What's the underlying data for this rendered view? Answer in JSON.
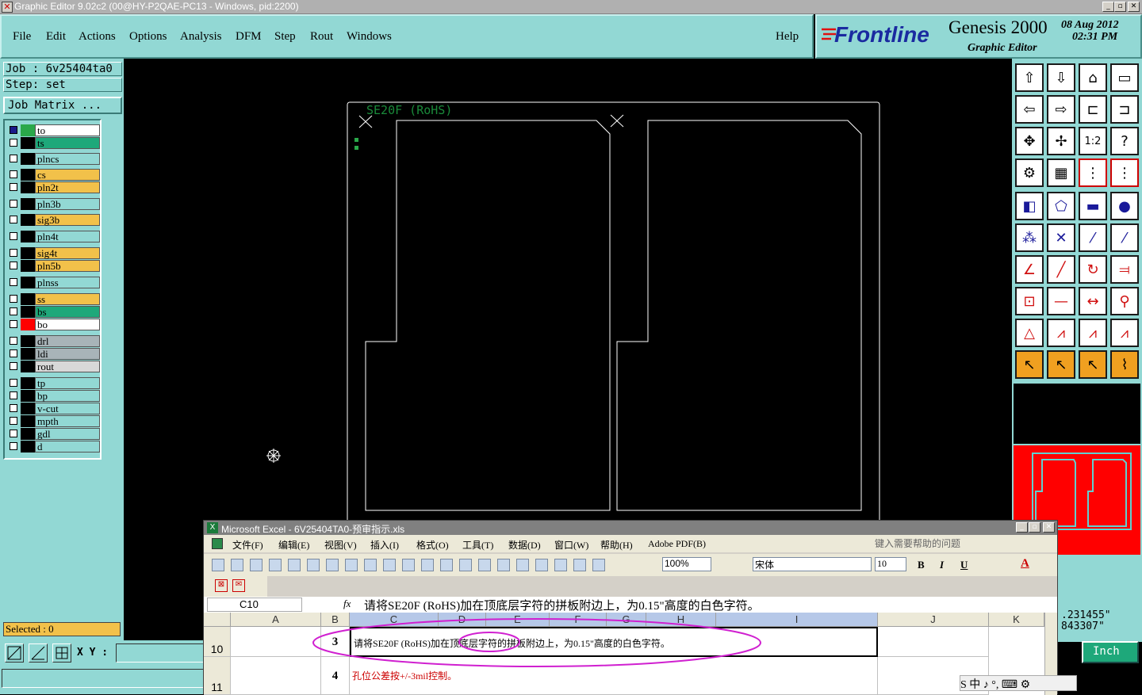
{
  "window": {
    "title": "Graphic Editor 9.02c2 (00@HY-P2QAE-PC13 - Windows, pid:2200)",
    "btn_min": "_",
    "btn_max": "▫",
    "btn_close": "✕"
  },
  "menu": {
    "items": [
      "File",
      "Edit",
      "Actions",
      "Options",
      "Analysis",
      "DFM",
      "Step",
      "Rout",
      "Windows"
    ],
    "help": "Help"
  },
  "brand": {
    "logo": "Frontline",
    "product": "Genesis 2000",
    "subtitle": "Graphic Editor",
    "date": "08 Aug 2012",
    "time": "02:31 PM"
  },
  "job": {
    "job": "Job : 6v25404ta0",
    "step": "Step: set",
    "matrix_button": "Job Matrix ..."
  },
  "layers": [
    {
      "name": "to",
      "color": "#ffffff",
      "accent": "#2aa84a"
    },
    {
      "name": "ts",
      "color": "#1ea87a",
      "accent": "#000000"
    },
    {
      "name": "plncs",
      "color": "#92d8d4",
      "accent": "#000000"
    },
    {
      "name": "cs",
      "color": "#f2c14a",
      "accent": "#000000"
    },
    {
      "name": "pln2t",
      "color": "#f2c14a",
      "accent": "#000000"
    },
    {
      "name": "pln3b",
      "color": "#92d8d4",
      "accent": "#000000"
    },
    {
      "name": "sig3b",
      "color": "#f2c14a",
      "accent": "#000000"
    },
    {
      "name": "pln4t",
      "color": "#92d8d4",
      "accent": "#000000"
    },
    {
      "name": "sig4t",
      "color": "#f2c14a",
      "accent": "#000000"
    },
    {
      "name": "pln5b",
      "color": "#f2c14a",
      "accent": "#000000"
    },
    {
      "name": "plnss",
      "color": "#92d8d4",
      "accent": "#000000"
    },
    {
      "name": "ss",
      "color": "#f2c14a",
      "accent": "#000000"
    },
    {
      "name": "bs",
      "color": "#1ea87a",
      "accent": "#000000"
    },
    {
      "name": "bo",
      "color": "#ffffff",
      "accent": "#ff0000"
    },
    {
      "name": "drl",
      "color": "#a8b4b8",
      "accent": "#000000"
    },
    {
      "name": "ldi",
      "color": "#a8b4b8",
      "accent": "#000000"
    },
    {
      "name": "rout",
      "color": "#d8d8d8",
      "accent": "#000000"
    },
    {
      "name": "tp",
      "color": "#92d8d4",
      "accent": "#000000"
    },
    {
      "name": "bp",
      "color": "#92d8d4",
      "accent": "#000000"
    },
    {
      "name": "v-cut",
      "color": "#92d8d4",
      "accent": "#000000"
    },
    {
      "name": "mpth",
      "color": "#92d8d4",
      "accent": "#000000"
    },
    {
      "name": "gdl",
      "color": "#92d8d4",
      "accent": "#000000"
    },
    {
      "name": "d",
      "color": "#92d8d4",
      "accent": "#000000"
    }
  ],
  "status": {
    "selected": "Selected : 0",
    "xy_label": "X Y :",
    "unit": "Inch",
    "coord1": ".231455\"",
    "coord2": "843307\""
  },
  "canvas": {
    "label": "SE20F (RoHS)"
  },
  "tools": {
    "icons": [
      "upload-icon",
      "download-icon",
      "home-icon",
      "window-icon",
      "import-icon",
      "export-icon",
      "step-icon",
      "snake-icon",
      "fit-icon",
      "zoom-icon",
      "scale-label",
      "help-icon",
      "config-icon",
      "grid-icon",
      "align-icon",
      "align2-icon"
    ],
    "scale_text": "1:2",
    "help_text": "?"
  },
  "excel": {
    "title": "Microsoft Excel - 6V25404TA0-预审指示.xls",
    "menu": [
      "文件(F)",
      "编辑(E)",
      "视图(V)",
      "插入(I)",
      "格式(O)",
      "工具(T)",
      "数据(D)",
      "窗口(W)",
      "帮助(H)",
      "Adobe PDF(B)"
    ],
    "help_placeholder": "键入需要帮助的问题",
    "zoom": "100%",
    "font": "宋体",
    "size": "10",
    "bold": "B",
    "italic": "I",
    "underline": "U",
    "cell_ref": "C10",
    "fx": "fx",
    "formula": "请将SE20F (RoHS)加在顶底层字符的拼板附边上，为0.15\"高度的白色字符。",
    "columns": [
      "A",
      "B",
      "C",
      "D",
      "E",
      "F",
      "G",
      "H",
      "I",
      "J",
      "K"
    ],
    "rows": [
      {
        "num": "10",
        "b": "3",
        "c": "请将SE20F (RoHS)加在顶底层字符的拼板附边上，为0.15\"高度的白色字符。"
      },
      {
        "num": "11",
        "b": "4",
        "c": "孔位公差按+/-3mil控制。"
      }
    ],
    "ime": "S 中 ♪ °, ⌨ ⚙"
  }
}
